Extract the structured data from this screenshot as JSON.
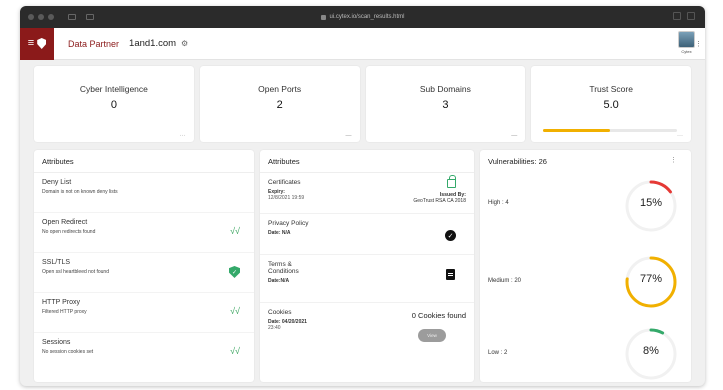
{
  "browser": {
    "url": "ui.cytex.io/scan_results.html"
  },
  "header": {
    "partner_label": "Data Partner",
    "domain": "1and1.com",
    "user_label": "Cytex"
  },
  "stats": [
    {
      "label": "Cyber Intelligence",
      "value": "0"
    },
    {
      "label": "Open Ports",
      "value": "2"
    },
    {
      "label": "Sub Domains",
      "value": "3"
    },
    {
      "label": "Trust Score",
      "value": "5.0",
      "progress": 0.5
    }
  ],
  "attributes_left": {
    "title": "Attributes",
    "items": [
      {
        "title": "Deny List",
        "desc": "Domain is not on known deny lists",
        "icon": "document-icon"
      },
      {
        "title": "Open Redirect",
        "desc": "No open redirects found",
        "icon": "check-icon"
      },
      {
        "title": "SSL/TLS",
        "desc": "Open ssl heartbleed not found",
        "icon": "shield-check-icon"
      },
      {
        "title": "HTTP Proxy",
        "desc": "Filtered HTTP proxy",
        "icon": "check-icon"
      },
      {
        "title": "Sessions",
        "desc": "No session cookies set",
        "icon": "check-icon"
      }
    ]
  },
  "attributes_mid": {
    "title": "Attributes",
    "certificates": {
      "title": "Certificates",
      "expiry_label": "Expiry:",
      "expiry": "12/8/2021 19:59",
      "issued_label": "Issued By:",
      "issued_by": "GeoTrust RSA CA 2018"
    },
    "privacy": {
      "title": "Privacy Policy",
      "date": "Date: N/A"
    },
    "terms": {
      "title": "Terms & Conditions",
      "date": "Date:N/A"
    },
    "cookies": {
      "title": "Cookies",
      "date_label": "Date: 04/20/2021",
      "time": "23:40",
      "count": "0 Cookies found",
      "button": "View"
    }
  },
  "vulnerabilities": {
    "title": "Vulnerabilities: 26",
    "rows": [
      {
        "label": "High : 4",
        "pct": "15%",
        "value": 0.15,
        "color": "#e53935"
      },
      {
        "label": "Medium : 20",
        "pct": "77%",
        "value": 0.77,
        "color": "#f1b000"
      },
      {
        "label": "Low : 2",
        "pct": "8%",
        "value": 0.08,
        "color": "#34a96a"
      }
    ]
  }
}
